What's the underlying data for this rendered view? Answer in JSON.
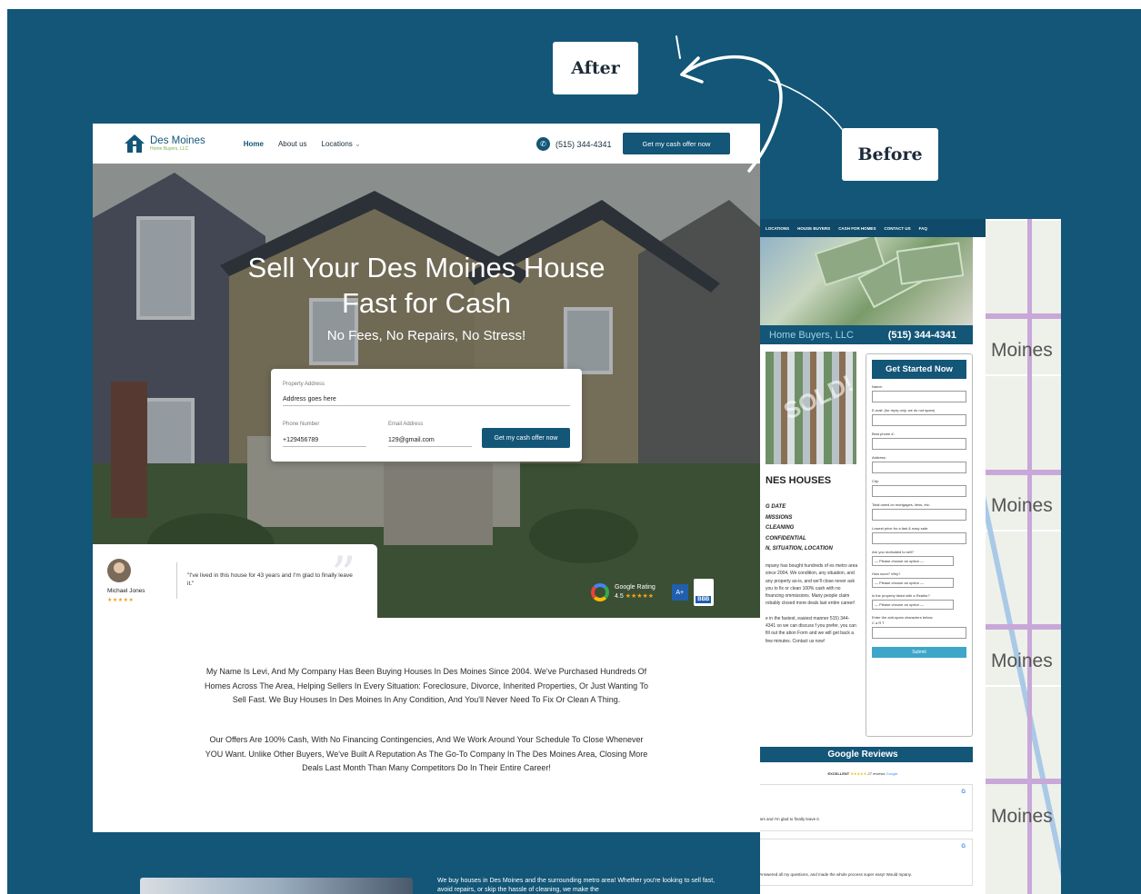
{
  "labels": {
    "after": "After",
    "before": "Before"
  },
  "colors": {
    "brand": "#135677",
    "accent_green": "#7ab24a",
    "star": "#f0a020"
  },
  "after": {
    "logo": {
      "line1": "Des Moines",
      "line2": "Home Buyers, LLC",
      "icon": "house-icon"
    },
    "nav": {
      "home": "Home",
      "about": "About us",
      "locations": "Locations"
    },
    "phone": "(515) 344-4341",
    "cta": "Get my cash offer now",
    "hero": {
      "title_line1": "Sell Your Des Moines House",
      "title_line2": "Fast for Cash",
      "subtitle": "No Fees, No Repairs, No Stress!"
    },
    "form": {
      "address_label": "Property Address",
      "address_value": "Address goes here",
      "phone_label": "Phone Number",
      "phone_value": "+129456789",
      "email_label": "Email Address",
      "email_value": "129@gmail.com",
      "submit": "Get my cash offer now"
    },
    "testimonial": {
      "quote": "\"I've lived in this house for 43 years and I'm glad to finally leave it.\"",
      "name": "Michael Jones",
      "stars": "★★★★★"
    },
    "rating": {
      "label": "Google Rating",
      "score": "4.5",
      "stars": "★★★★★",
      "bbb_grade": "A+",
      "bbb": "BBB"
    },
    "about": {
      "p1": "My Name Is Levi, And My Company Has Been Buying Houses In Des Moines Since 2004. We've Purchased Hundreds Of Homes Across The Area, Helping Sellers In Every Situation: Foreclosure, Divorce, Inherited Properties, Or Just Wanting To Sell Fast. We Buy Houses In Des Moines In Any Condition, And You'll Never Need To Fix Or Clean A Thing.",
      "p2": "Our Offers Are 100% Cash, With No Financing Contingencies, And We Work Around Your Schedule To Close Whenever YOU Want. Unlike Other Buyers, We've Built A Reputation As The Go-To Company In The Des Moines Area, Closing More Deals Last Month Than Many Competitors Do In Their Entire Career!"
    },
    "band_text": "We buy houses in Des Moines and the surrounding metro area! Whether you're looking to sell fast, avoid repairs, or skip the hassle of cleaning, we make the"
  },
  "before": {
    "nav": [
      "LOCATIONS",
      "HOUSE BUYERS",
      "CASH FOR HOMES",
      "CONTACT US",
      "FAQ"
    ],
    "brand_partial": "Home Buyers, LLC",
    "phone": "(515) 344-4341",
    "sold": "SOLD!",
    "heading": "NES HOUSES",
    "list": [
      "G DATE",
      "MISSIONS",
      "CLEANING",
      "CONFIDENTIAL",
      "N, SITUATION, LOCATION"
    ],
    "paragraph": "mpany has bought hundreds of es metro area since 2004. We condition, any situation, and any property as-is, and we'll close never ask you to fix or clean 100% cash with no financing ommissions. Many people claim robably closed more deals last entire career!",
    "paragraph2": "e in the fastest, easiest manner 515) 344-4341 so we can discuss f you prefer, you can fill out the ation Form and we will get back a few minutes. Contact us now!",
    "form": {
      "title": "Get Started Now",
      "fields": [
        "Name:",
        "E-mail: (for reply only, we do not spam)",
        "Best phone #:",
        "Address:",
        "City:",
        "Total owed on mortgages, liens, etc:",
        "Lowest price for a fast & easy sale:"
      ],
      "selects": [
        {
          "label": "Are you motivated to sell?",
          "value": "— Please choose an option —"
        },
        {
          "label": "How soon? Why?",
          "value": "— Please choose an option —"
        },
        {
          "label": "Is the property listed with a Realtor?",
          "value": "— Please choose an option —"
        }
      ],
      "captcha_label": "Enter the anti-spam characters below:",
      "captcha": "C a R T",
      "submit": "Submit"
    },
    "reviews_title": "Google Reviews",
    "excellent": "EXCELLENT",
    "excellent_stars": "★★★★★",
    "review_count": "27 reviews",
    "google": "Google",
    "reviews": [
      "ears and I'm glad to finally leave it.",
      "! Answered all my questions, and made the whole process super easy! Would mpany."
    ],
    "map_label": "Moines"
  }
}
